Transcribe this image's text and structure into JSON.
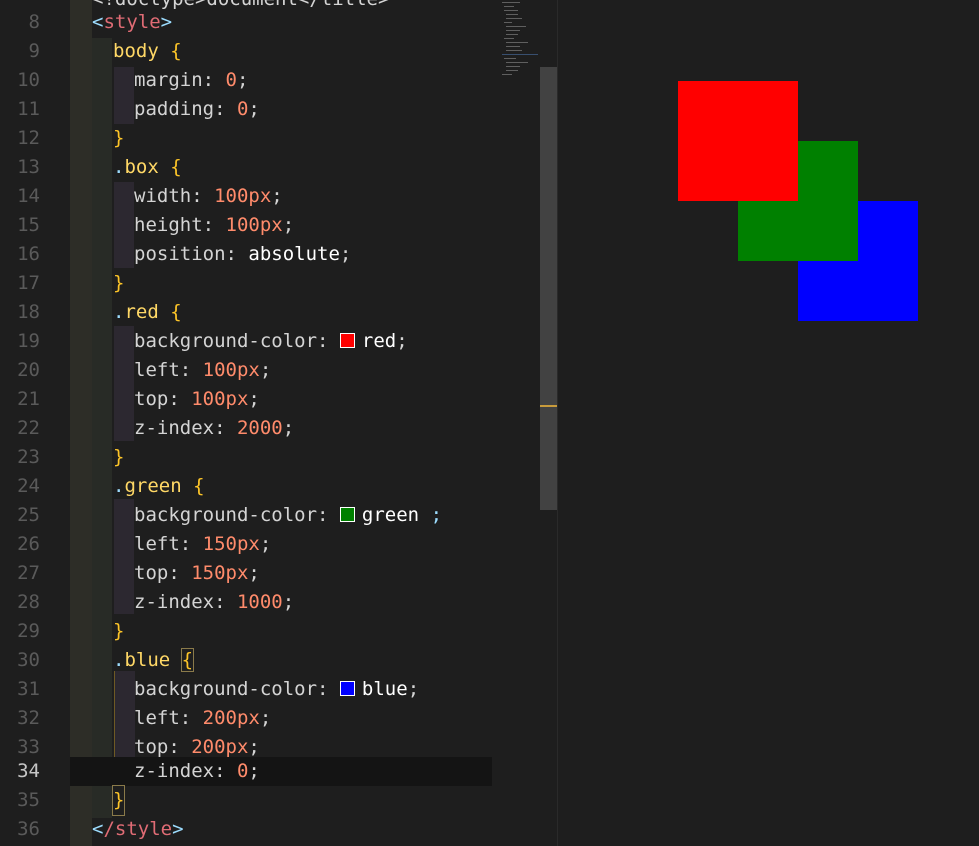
{
  "editor": {
    "partial_top_line": "<!doctype>document</title>",
    "lines": [
      {
        "n": "8",
        "text": "<style>"
      },
      {
        "n": "9",
        "text": "body {"
      },
      {
        "n": "10",
        "text": "margin: 0;"
      },
      {
        "n": "11",
        "text": "padding: 0;"
      },
      {
        "n": "12",
        "text": "}"
      },
      {
        "n": "13",
        "text": ".box {"
      },
      {
        "n": "14",
        "text": "width: 100px;"
      },
      {
        "n": "15",
        "text": "height: 100px;"
      },
      {
        "n": "16",
        "text": "position: absolute;"
      },
      {
        "n": "17",
        "text": "}"
      },
      {
        "n": "18",
        "text": ".red {"
      },
      {
        "n": "19",
        "text": "background-color: red;"
      },
      {
        "n": "20",
        "text": "left: 100px;"
      },
      {
        "n": "21",
        "text": "top: 100px;"
      },
      {
        "n": "22",
        "text": "z-index: 2000;"
      },
      {
        "n": "23",
        "text": "}"
      },
      {
        "n": "24",
        "text": ".green {"
      },
      {
        "n": "25",
        "text": "background-color: green ;"
      },
      {
        "n": "26",
        "text": "left: 150px;"
      },
      {
        "n": "27",
        "text": "top: 150px;"
      },
      {
        "n": "28",
        "text": "z-index: 1000;"
      },
      {
        "n": "29",
        "text": "}"
      },
      {
        "n": "30",
        "text": ".blue {"
      },
      {
        "n": "31",
        "text": "background-color: blue;"
      },
      {
        "n": "32",
        "text": "left: 200px;"
      },
      {
        "n": "33",
        "text": "top: 200px;"
      },
      {
        "n": "34",
        "text": "z-index: 0;"
      },
      {
        "n": "35",
        "text": "}"
      },
      {
        "n": "36",
        "text": "</style>"
      }
    ],
    "tokens": {
      "style_open": "style",
      "style_close": "/style",
      "body": "body",
      "box": "box",
      "red": "red",
      "green": "green",
      "blue": "blue",
      "margin": "margin",
      "padding": "padding",
      "width": "width",
      "height": "height",
      "position": "position",
      "background_color": "background-color",
      "left": "left",
      "top": "top",
      "z_index": "z-index",
      "zero": "0",
      "px100": "100px",
      "px150": "150px",
      "px200": "200px",
      "absolute": "absolute",
      "z2000": "2000",
      "z1000": "1000",
      "z0": "0"
    }
  },
  "colors": {
    "red": "#ff0000",
    "green": "#008000",
    "blue": "#0000ff"
  },
  "preview": {
    "boxes": [
      "red",
      "green",
      "blue"
    ]
  }
}
